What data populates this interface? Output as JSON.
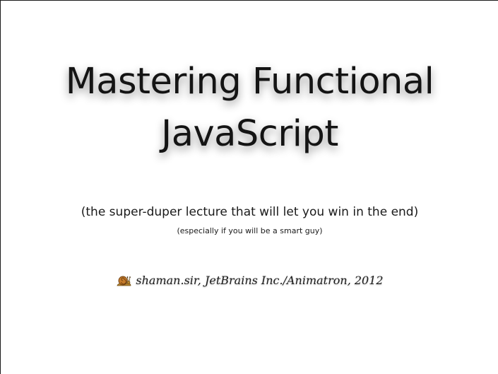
{
  "slide": {
    "title_line1": "Mastering Functional",
    "title_line2": "JavaScript",
    "subtitle": "(the super-duper lecture that will let you win in the end)",
    "subsubtitle": "(especially if you will be a smart guy)",
    "author": "shaman.sir, JetBrains Inc./Animatron, 2012",
    "author_icon": "snail-icon"
  }
}
